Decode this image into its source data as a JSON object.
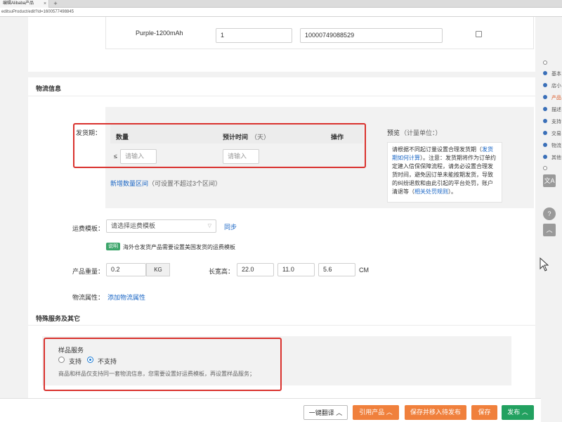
{
  "browser": {
    "tab_title": "编辑Alibaba产品",
    "tab_close": "×",
    "new_tab": "+",
    "url": "editsuProduct/edit?id=1600577498845"
  },
  "variant_row": {
    "name": "Purple-1200mAh",
    "quantity": "1",
    "sku_code": "10000749088529"
  },
  "logistics": {
    "title": "物流信息",
    "delivery_label": "发货期：",
    "table": {
      "col_quantity": "数量",
      "col_time": "预计时间",
      "col_time_unit": "（天）",
      "col_action": "操作",
      "row_prefix": "≤",
      "qty_placeholder": "请输入",
      "time_placeholder": "请输入"
    },
    "add_range_link": "新增数量区间",
    "add_range_hint": "（可设置不超过3个区间）",
    "preview": {
      "title": "预览",
      "title_unit": "（计量单位：）",
      "text_1": "请根据不同起订量设置合理发货期（",
      "link_1": "发货期如何计算",
      "text_2": "）。注意：发货期将作为订单约定建入信保保障流程，请务必设置合理发货时间，避免因订单未能按期发货，导致的纠纷退款和由此引起的平台处罚，账户清退等（",
      "link_2": "相关处罚规则",
      "text_3": "）。"
    },
    "shipping_template_label": "运费模板：",
    "shipping_template_placeholder": "请选择运费模板",
    "sync_link": "同步",
    "tip_tag": "说明",
    "tip_text": "海外仓发货产品需要设置美国发货的运费模板",
    "weight_label": "产品重量：",
    "weight_value": "0.2",
    "weight_unit": "KG",
    "dims_label": "长宽高：",
    "length": "22.0",
    "width": "11.0",
    "height": "5.6",
    "dims_unit": "CM",
    "attr_label": "物流属性：",
    "attr_link": "添加物流属性"
  },
  "special": {
    "title": "特殊服务及其它",
    "sample_title": "样品服务",
    "option_yes": "支持",
    "option_no": "不支持",
    "sample_hint": "商品和样品仅支持同一套物流信息，您需要设置好运费模板，再设置样品服务；"
  },
  "sidenav": {
    "items": [
      "基本",
      "店小",
      "产品",
      "描述",
      "支持",
      "交易",
      "物流",
      "其他"
    ],
    "active_index": 2,
    "translate_icon": "文A",
    "help_icon": "?",
    "top_icon": "︿"
  },
  "footer": {
    "translate_btn": "一键翻译 ︿",
    "quote_btn": "引用产品 ︿",
    "save_move_btn": "保存并移入待发布",
    "save_btn": "保存",
    "publish_btn": "发布 ︿"
  },
  "colors": {
    "accent_blue": "#1a66c5",
    "highlight_red": "#d9312d",
    "orange": "#f0803c",
    "green": "#22a160"
  }
}
